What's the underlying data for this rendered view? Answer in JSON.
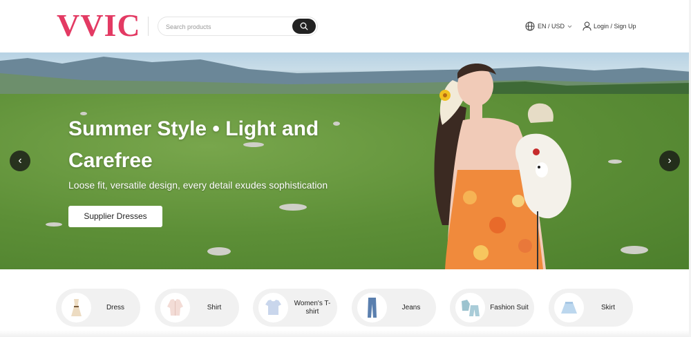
{
  "header": {
    "logo": "VVIC",
    "search": {
      "placeholder": "Search products",
      "value": "",
      "button_icon": "search-icon"
    },
    "language": {
      "label": "EN / USD",
      "icon": "globe-icon"
    },
    "account": {
      "label": "Login / Sign Up",
      "icon": "user-icon"
    }
  },
  "hero": {
    "title": "Summer Style • Light and Carefree",
    "subtitle": "Loose fit, versatile design, every detail exudes sophistication",
    "cta_label": "Supplier Dresses",
    "prev_arrow": "‹",
    "next_arrow": "›"
  },
  "categories": [
    {
      "label": "Dress",
      "icon": "dress-icon"
    },
    {
      "label": "Shirt",
      "icon": "shirt-icon"
    },
    {
      "label": "Women's T-shirt",
      "icon": "tshirt-icon"
    },
    {
      "label": "Jeans",
      "icon": "jeans-icon"
    },
    {
      "label": "Fashion Suit",
      "icon": "suit-icon"
    },
    {
      "label": "Skirt",
      "icon": "skirt-icon"
    }
  ],
  "colors": {
    "brand": "#e33a63",
    "search_button": "#222222",
    "category_bg": "#f1f1f1"
  }
}
